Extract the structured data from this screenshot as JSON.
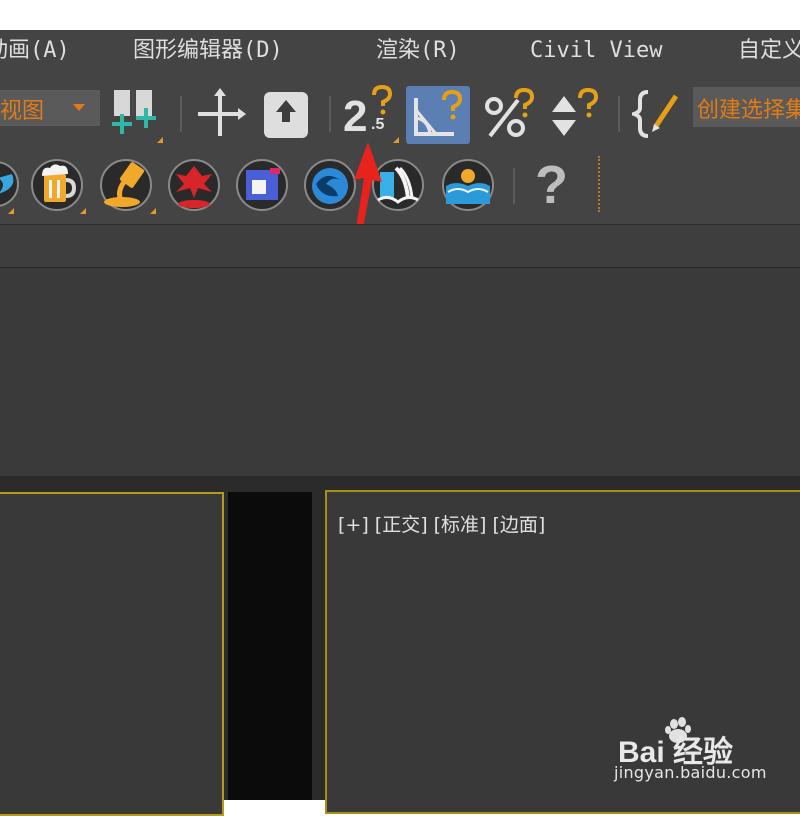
{
  "menu": {
    "items": [
      {
        "label": "动画(A)"
      },
      {
        "label": "图形编辑器(D)"
      },
      {
        "label": "渲染(R)"
      },
      {
        "label": "Civil View"
      },
      {
        "label": "自定义"
      }
    ]
  },
  "toolbar": {
    "view_dropdown": "视图",
    "named_selection_placeholder": "创建选择集",
    "spinner_snap_badge": "2.5",
    "spinner_snap_main": "2",
    "spinner_snap_sub": ".5",
    "help_icon": "?"
  },
  "viewport": {
    "label": "[+] [正交] [标准] [边面]"
  },
  "watermark": {
    "brand": "Bai 经验",
    "url": "jingyan.baidu.com"
  },
  "colors": {
    "accent": "#e07b16",
    "viewport_border": "#b49b1c",
    "arrow": "#e8231e",
    "active_button": "#5b7fb3"
  }
}
